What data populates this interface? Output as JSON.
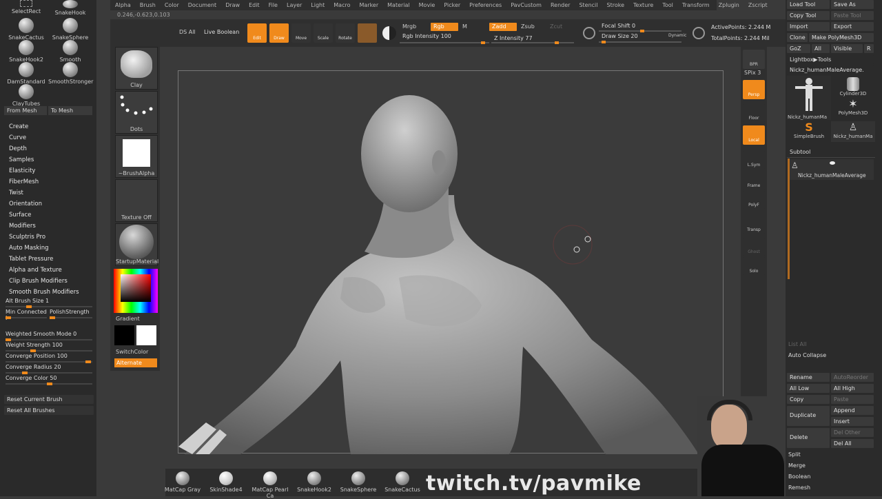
{
  "menu": [
    "Alpha",
    "Brush",
    "Color",
    "Document",
    "Draw",
    "Edit",
    "File",
    "Layer",
    "Light",
    "Macro",
    "Marker",
    "Material",
    "Movie",
    "Picker",
    "Preferences",
    "PavCustom",
    "Render",
    "Stencil",
    "Stroke",
    "Texture",
    "Tool",
    "Transform",
    "Zplugin",
    "Zscript"
  ],
  "coords": "0.246,-0.623,0.103",
  "toolbar": {
    "ds_all": "DS All",
    "live_boolean": "Live Boolean",
    "edit": "Edit",
    "draw": "Draw",
    "move": "Move",
    "scale": "Scale",
    "rotate": "Rotate",
    "mrgb": "Mrgb",
    "rgb": "Rgb",
    "m": "M",
    "rgb_intensity": "Rgb Intensity 100",
    "zadd": "Zadd",
    "zsub": "Zsub",
    "zcut": "Zcut",
    "z_intensity": "Z Intensity 77",
    "focal_shift": "Focal Shift 0",
    "draw_size": "Draw Size 20",
    "dynamic": "Dynamic",
    "active_points": "ActivePoints: 2.244 M",
    "total_points": "TotalPoints: 2.244 Mil"
  },
  "left": {
    "brushes": [
      "SelectRect",
      "SnakeHook",
      "SnakeCactus",
      "SnakeSphere",
      "SnakeHook2",
      "Smooth",
      "DamStandard",
      "SmoothStronger",
      "ClayTubes"
    ],
    "from_mesh": "From Mesh",
    "to_mesh": "To Mesh",
    "items": [
      "Create",
      "Curve",
      "Depth",
      "Samples",
      "Elasticity",
      "FiberMesh",
      "Twist",
      "Orientation",
      "Surface",
      "Modifiers",
      "Sculptris Pro",
      "Auto Masking",
      "Tablet Pressure",
      "Alpha and Texture",
      "Clip Brush Modifiers",
      "Smooth Brush Modifiers"
    ],
    "alt_brush_size": "Alt Brush Size 1",
    "min_connected": "Min Connected I",
    "polish_strength": "PolishStrength",
    "weighted_smooth": "Weighted Smooth Mode 0",
    "weight_strength": "Weight Strength 100",
    "converge_position": "Converge Position 100",
    "converge_radius": "Converge Radius 20",
    "converge_color": "Converge Color 50",
    "reset_current": "Reset Current Brush",
    "reset_all": "Reset All Brushes"
  },
  "mid": {
    "clay": "Clay",
    "dots": "Dots",
    "brush_alpha": "~BrushAlpha",
    "texture_off": "Texture Off",
    "startup_material": "StartupMaterial",
    "gradient": "Gradient",
    "switch_color": "SwitchColor",
    "alternate": "Alternate"
  },
  "righttools": [
    "BPR",
    "SPix 3",
    "Persp",
    "Floor",
    "Local",
    "L.Sym",
    "Frame",
    "PolyF",
    "Transp",
    "Ghost",
    "Solo"
  ],
  "right": {
    "load_tool": "Load Tool",
    "save_as": "Save As",
    "copy_tool": "Copy Tool",
    "paste_tool": "Paste Tool",
    "import": "Import",
    "export": "Export",
    "clone": "Clone",
    "make_polymesh": "Make PolyMesh3D",
    "goz": "GoZ",
    "all": "All",
    "visible": "Visible",
    "r": "R",
    "lightbox": "Lightbox▶Tools",
    "current_tool": "Nickz_humanMaleAverage.",
    "thumbs": [
      "Nickz_humanMa",
      "Cylinder3D",
      "PolyMesh3D",
      "SimpleBrush",
      "Nickz_humanMa"
    ],
    "subtool": "Subtool",
    "subtool_item": "Nickz_humanMaleAverage",
    "list_all": "List All",
    "auto_collapse": "Auto Collapse",
    "rename": "Rename",
    "autoreorder": "AutoReorder",
    "all_low": "All Low",
    "all_high": "All High",
    "copy": "Copy",
    "paste": "Paste",
    "duplicate": "Duplicate",
    "append": "Append",
    "insert": "Insert",
    "delete": "Delete",
    "del_other": "Del Other",
    "del_all": "Del All",
    "split": "Split",
    "merge": "Merge",
    "boolean": "Boolean",
    "remesh": "Remesh"
  },
  "materials": [
    "MatCap Gray",
    "SkinShade4",
    "MatCap Pearl Ca",
    "SnakeHook2",
    "SnakeSphere",
    "SnakeCactus"
  ],
  "watermark": "twitch.tv/pavmike",
  "colors": {
    "accent": "#f08a1c",
    "bg": "#3a3a3a"
  }
}
